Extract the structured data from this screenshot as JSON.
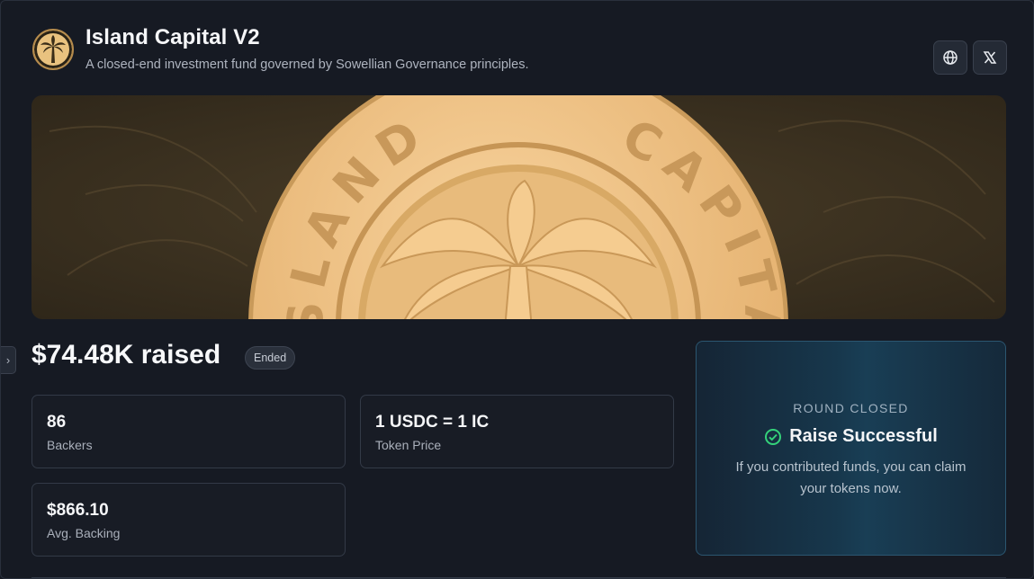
{
  "header": {
    "title": "Island Capital V2",
    "subtitle": "A closed-end investment fund governed by Sowellian Governance principles.",
    "logo_icon": "palm-tree-icon",
    "actions": [
      {
        "icon": "globe-icon"
      },
      {
        "icon": "x-logo-icon"
      }
    ]
  },
  "banner": {
    "coin_text_left": "ISLAND",
    "coin_text_right": "CAPITAL",
    "colors": {
      "background": "#3b3120",
      "coin": "#f3c689",
      "coin_shadow": "#c99a5a"
    }
  },
  "raise": {
    "amount": "$74.48K raised",
    "status_badge": "Ended"
  },
  "stats": [
    {
      "value": "86",
      "label": "Backers"
    },
    {
      "value": "1 USDC = 1 IC",
      "label": "Token Price"
    },
    {
      "value": "$866.10",
      "label": "Avg. Backing"
    }
  ],
  "round": {
    "label": "ROUND CLOSED",
    "status": "Raise Successful",
    "message": "If you contributed funds, you can claim your tokens now.",
    "status_color": "#34d27a"
  },
  "sidebar_toggle": {
    "icon": "chevron-right-icon"
  }
}
